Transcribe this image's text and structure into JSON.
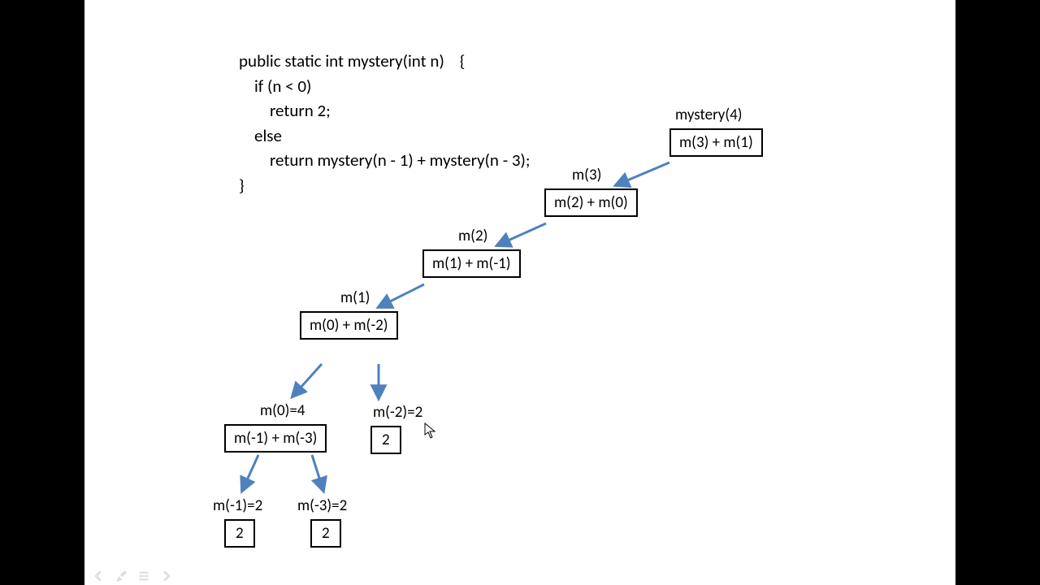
{
  "code": {
    "l1": "public static int mystery(int n)    {",
    "l2": "    if (n < 0)",
    "l3": "        return 2;",
    "l4": "    else",
    "l5": "        return mystery(n - 1) + mystery(n - 3);",
    "l6": "}"
  },
  "nodes": {
    "n4": {
      "label": "mystery(4)",
      "box": "m(3) + m(1)"
    },
    "n3": {
      "label": "m(3)",
      "box": "m(2) + m(0)"
    },
    "n2": {
      "label": "m(2)",
      "box": "m(1) + m(-1)"
    },
    "n1": {
      "label": "m(1)",
      "box": "m(0) + m(-2)"
    },
    "n0": {
      "label": "m(0)=4",
      "box": "m(-1) + m(-3)"
    },
    "nm2": {
      "label": "m(-2)=2",
      "box": "2"
    },
    "nm1": {
      "label": "m(-1)=2",
      "box": "2"
    },
    "nm3": {
      "label": "m(-3)=2",
      "box": "2"
    }
  }
}
